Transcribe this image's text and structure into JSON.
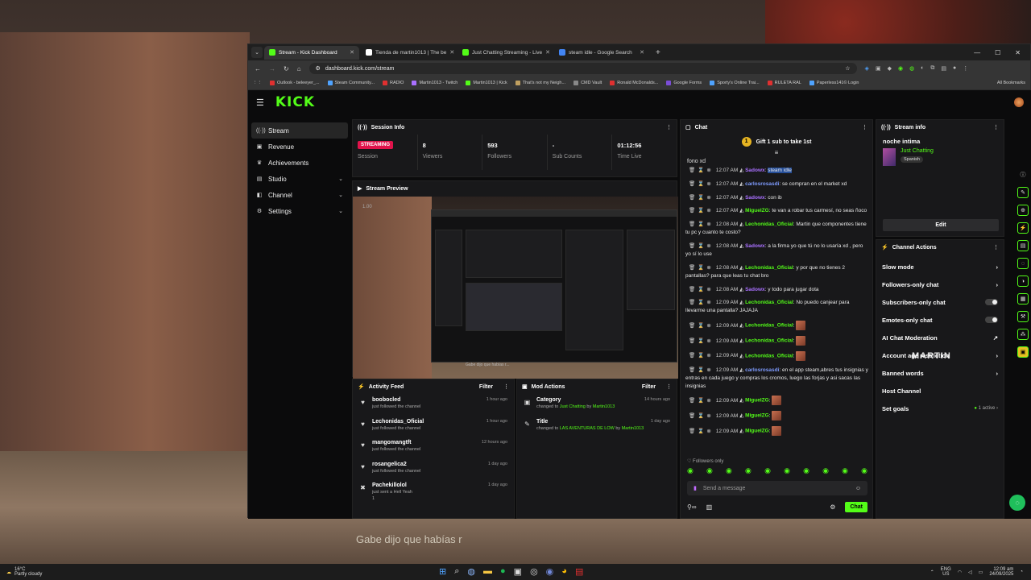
{
  "browser": {
    "tabs": [
      {
        "title": "Stream - Kick Dashboard",
        "color": "#53fc18",
        "active": true
      },
      {
        "title": "Tienda de martin1013 | The be",
        "color": "#ffffff",
        "active": false
      },
      {
        "title": "Just Chatting Streaming - Live",
        "color": "#53fc18",
        "active": false
      },
      {
        "title": "steam idle - Google Search",
        "color": "#4285f4",
        "active": false
      }
    ],
    "url": "dashboard.kick.com/stream",
    "bookmarks": [
      "Outlook - beleeyer_...",
      "Steam Community...",
      "RADIO",
      "Martin1013 - Twitch",
      "Martin1013 | Kick",
      "That's not my Neigh...",
      "CMD Vault",
      "Ronald McDonalds...",
      "Google Forms",
      "Sporty's Online Trai...",
      "RULETA RAL",
      "Paperless141© Login"
    ],
    "all_bookmarks": "All Bookmarks"
  },
  "brand": {
    "logo": "KICK",
    "accent": "#53fc18"
  },
  "sidebar": {
    "items": [
      {
        "label": "Stream",
        "icon": "broadcast-icon",
        "active": true
      },
      {
        "label": "Revenue",
        "icon": "wallet-icon"
      },
      {
        "label": "Achievements",
        "icon": "trophy-icon"
      },
      {
        "label": "Studio",
        "icon": "studio-icon",
        "expand": true
      },
      {
        "label": "Channel",
        "icon": "channel-icon",
        "expand": true
      },
      {
        "label": "Settings",
        "icon": "gear-icon",
        "expand": true
      }
    ]
  },
  "session": {
    "title": "Session Info",
    "badge": "STREAMING",
    "stats": [
      {
        "value": "",
        "label": "Session"
      },
      {
        "value": "8",
        "label": "Viewers"
      },
      {
        "value": "593",
        "label": "Followers"
      },
      {
        "value": "-",
        "label": "Sub Counts"
      },
      {
        "value": "01:12:56",
        "label": "Time Live"
      }
    ]
  },
  "preview": {
    "title": "Stream Preview",
    "time": "1.00",
    "caption": "Gabe dijo que habías r..."
  },
  "activity": {
    "title": "Activity Feed",
    "filter": "Filter",
    "items": [
      {
        "name": "boobocled",
        "sub": "just followed the channel",
        "time": "1 hour ago"
      },
      {
        "name": "Lechonidas_Oficial",
        "sub": "just followed the channel",
        "time": "1 hour ago"
      },
      {
        "name": "mangomangtft",
        "sub": "just followed the channel",
        "time": "12 hours ago"
      },
      {
        "name": "rosangelica2",
        "sub": "just followed the channel",
        "time": "1 day ago"
      },
      {
        "name": "Pachekillolol",
        "sub": "just sent a Hell Yeah",
        "time": "1 day ago",
        "extra": "1"
      }
    ]
  },
  "mod": {
    "title": "Mod Actions",
    "filter": "Filter",
    "items": [
      {
        "name": "Category",
        "pre": "changed to",
        "value": "Just Chatting",
        "by": "by",
        "user": "Martin1013",
        "time": "14 hours ago"
      },
      {
        "name": "Title",
        "pre": "changed to",
        "value": "LAS AVENTURAS DE LOW",
        "by": "by",
        "user": "Martin1013",
        "time": "1 day ago"
      }
    ]
  },
  "chat": {
    "title": "Chat",
    "gift": "Gift 1 sub to take 1st",
    "first_line": "fono xd",
    "messages": [
      {
        "time": "12:07 AM",
        "user": "Sadowx",
        "color": "#a970ff",
        "text": "steam idle",
        "sel": true
      },
      {
        "time": "12:07 AM",
        "user": "carlosrosasdi",
        "color": "#7f9cff",
        "text": "se compran en el market xd"
      },
      {
        "time": "12:07 AM",
        "user": "Sadowx",
        "color": "#a970ff",
        "text": "con ib"
      },
      {
        "time": "12:07 AM",
        "user": "MiguelZG",
        "color": "#53fc18",
        "text": "te van a robar tus carmesí, no seas ñoco"
      },
      {
        "time": "12:08 AM",
        "user": "Lechonidas_Oficial",
        "color": "#53fc18",
        "text": "Martin que componentes tiene tu pc y cuanto te costo?"
      },
      {
        "time": "12:08 AM",
        "user": "Sadowx",
        "color": "#a970ff",
        "text": "a la firma yo que tú no lo usaría xd , pero yo sí lo use"
      },
      {
        "time": "12:08 AM",
        "user": "Lechonidas_Oficial",
        "color": "#53fc18",
        "text": "y por que no tienes 2 pantallas? para que leas tu chat bro"
      },
      {
        "time": "12:08 AM",
        "user": "Sadowx",
        "color": "#a970ff",
        "text": "y todo para jugar dota"
      },
      {
        "time": "12:09 AM",
        "user": "Lechonidas_Oficial",
        "color": "#53fc18",
        "text": "No puedo canjear para llevarme una pantalla? JAJAJA"
      },
      {
        "time": "12:09 AM",
        "user": "Lechonidas_Oficial",
        "color": "#53fc18",
        "text": "",
        "emote": true
      },
      {
        "time": "12:09 AM",
        "user": "Lechonidas_Oficial",
        "color": "#53fc18",
        "text": "",
        "emote": true
      },
      {
        "time": "12:09 AM",
        "user": "Lechonidas_Oficial",
        "color": "#53fc18",
        "text": "",
        "emote": true
      },
      {
        "time": "12:09 AM",
        "user": "carlosrosasdi",
        "color": "#7f9cff",
        "text": "en el app steam,abres tus insignias y entras en cada juego y compras los cromos, luego las forjas y asi sacas las insignias"
      },
      {
        "time": "12:09 AM",
        "user": "MiguelZG",
        "color": "#53fc18",
        "text": "",
        "emote": true
      },
      {
        "time": "12:09 AM",
        "user": "MiguelZG",
        "color": "#53fc18",
        "text": "",
        "emote": true
      },
      {
        "time": "12:09 AM",
        "user": "MiguelZG",
        "color": "#53fc18",
        "text": "",
        "emote": true
      }
    ],
    "followers_only": "Followers only",
    "placeholder": "Send a message",
    "send": "Chat"
  },
  "stream_info": {
    "title": "Stream info",
    "stream_title": "noche intima",
    "category": "Just Chatting",
    "language": "Spanish",
    "edit": "Edit"
  },
  "channel_actions": {
    "title": "Channel Actions",
    "items": [
      {
        "label": "Slow mode",
        "ctrl": "chevron"
      },
      {
        "label": "Followers-only chat",
        "ctrl": "chevron"
      },
      {
        "label": "Subscribers-only chat",
        "ctrl": "toggle"
      },
      {
        "label": "Emotes-only chat",
        "ctrl": "toggle"
      },
      {
        "label": "AI Chat Moderation",
        "ctrl": "ext"
      },
      {
        "label": "Account age restriction",
        "ctrl": "chevron"
      },
      {
        "label": "Banned words",
        "ctrl": "chevron"
      },
      {
        "label": "Host Channel",
        "ctrl": "none"
      },
      {
        "label": "Set goals",
        "ctrl": "goal",
        "extra": "1 active"
      }
    ],
    "watermark": "MARTIN"
  },
  "taskbar": {
    "weather_temp": "16°C",
    "weather_desc": "Partly cloudy",
    "lang1": "ENG",
    "lang2": "US",
    "time": "12:09 am",
    "date": "24/09/2025"
  },
  "subtitle": "Gabe dijo que habías r"
}
